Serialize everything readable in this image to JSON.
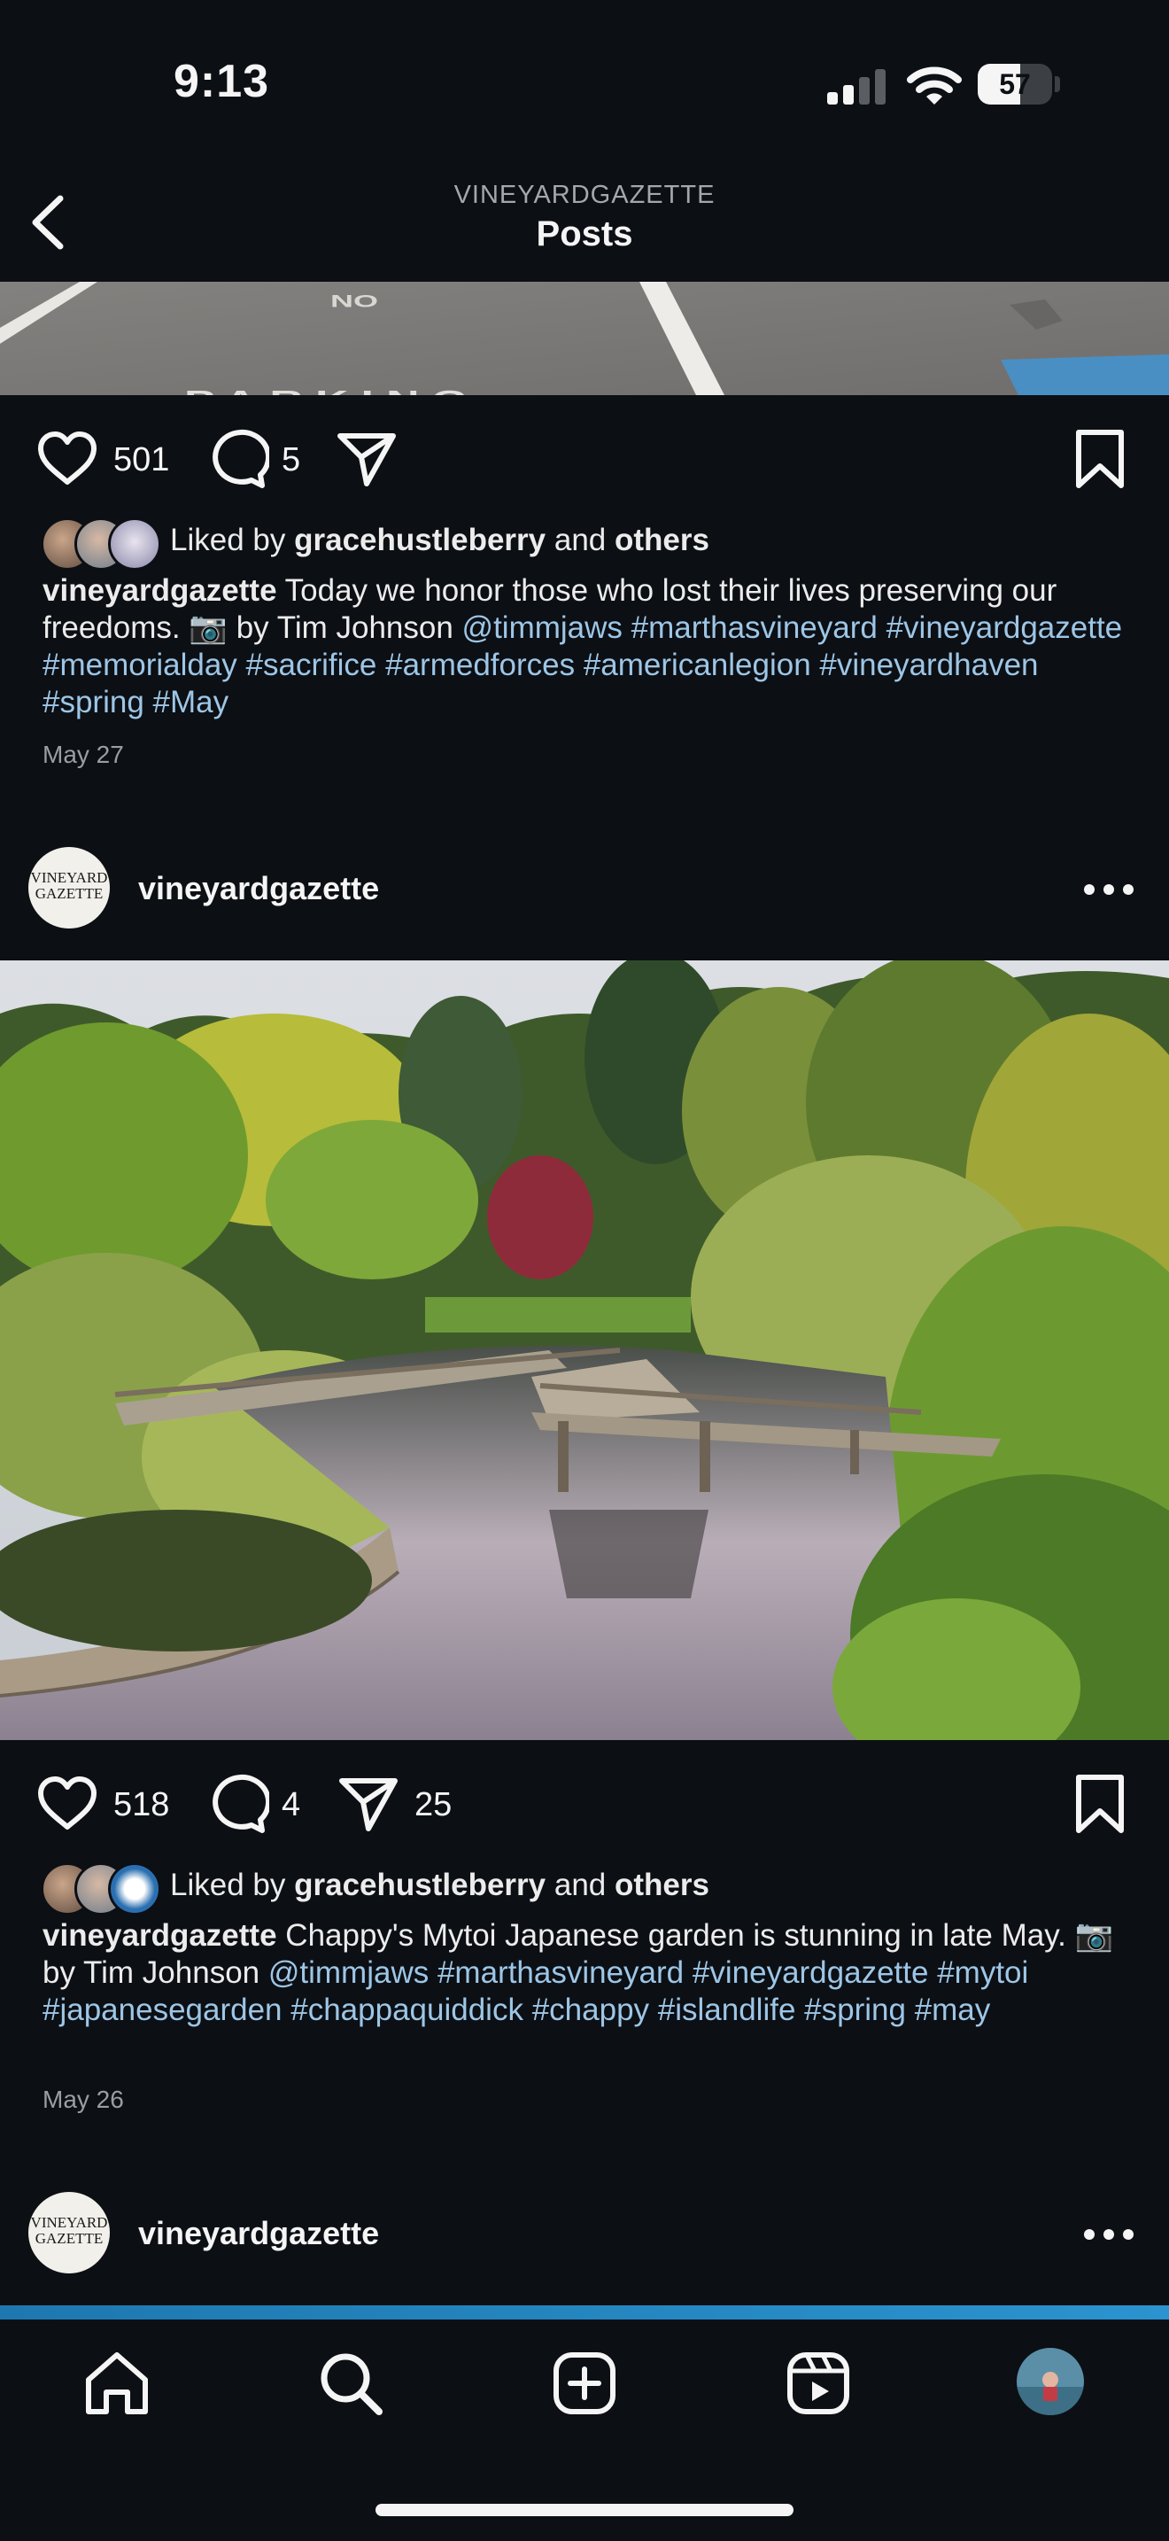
{
  "status_bar": {
    "time": "9:13",
    "battery": "57",
    "battery_level": 0.57
  },
  "header": {
    "account": "VINEYARDGAZETTE",
    "title": "Posts"
  },
  "posts": [
    {
      "image_text": [
        "NO",
        "PARKING"
      ],
      "likes": "501",
      "comments": "5",
      "liked_by_prefix": "Liked by",
      "liked_by_user": "gracehustleberry",
      "liked_by_and": "and",
      "liked_by_others": "others",
      "caption": {
        "username": "vineyardgazette",
        "text_1": "Today we honor those who lost their lives preserving our freedoms.",
        "camera_emoji": "📷",
        "text_2": "by Tim Johnson",
        "tags": [
          "@timmjaws",
          "#marthasvineyard",
          "#vineyardgazette",
          "#memorialday",
          "#sacrifice",
          "#armedforces",
          "#americanlegion",
          "#vineyardhaven",
          "#spring",
          "#May"
        ]
      },
      "date": "May 27"
    },
    {
      "username": "vineyardgazette",
      "avatar_text": [
        "VINEYARD",
        "GAZETTE"
      ],
      "likes": "518",
      "comments": "4",
      "shares": "25",
      "liked_by_prefix": "Liked by",
      "liked_by_user": "gracehustleberry",
      "liked_by_and": "and",
      "liked_by_others": "others",
      "caption": {
        "username": "vineyardgazette",
        "text_1": "Chappy's Mytoi Japanese garden is stunning in late May.",
        "camera_emoji": "📷",
        "text_2": "by Tim Johnson",
        "tags": [
          "@timmjaws",
          "#marthasvineyard",
          "#vineyardgazette",
          "#mytoi",
          "#japanesegarden",
          "#chappaquiddick",
          "#chappy",
          "#islandlife",
          "#spring",
          "#may"
        ]
      },
      "date": "May 26"
    },
    {
      "username": "vineyardgazette",
      "avatar_text": [
        "VINEYARD",
        "GAZETTE"
      ]
    }
  ],
  "icons": {
    "back": "chevron-left-icon",
    "like": "heart-icon",
    "comment": "comment-bubble-icon",
    "share": "paper-plane-icon",
    "save": "bookmark-icon",
    "more": "ellipsis-icon",
    "tabs": [
      "home-icon",
      "search-icon",
      "create-icon",
      "reels-icon",
      "profile-avatar"
    ]
  },
  "colors": {
    "background": "#0c0f14",
    "link": "#9dc6e6",
    "secondary_text": "#9a9ea4"
  }
}
